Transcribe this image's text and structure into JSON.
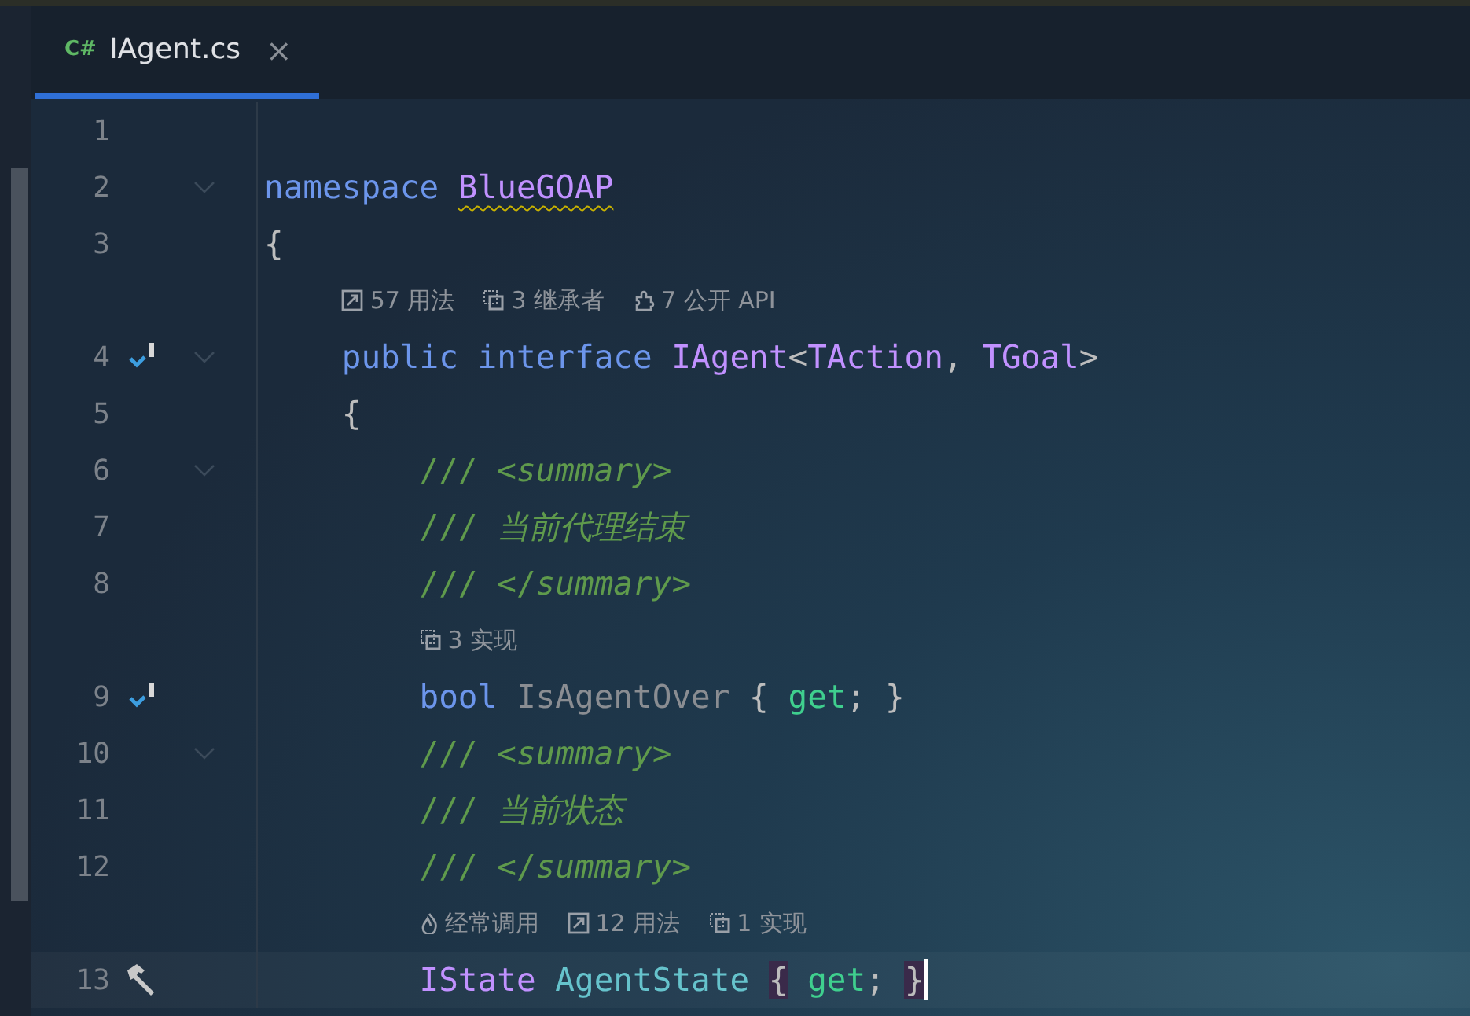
{
  "tab": {
    "lang": "C#",
    "title": "IAgent.cs",
    "close": "×",
    "selected": true
  },
  "lines": [
    {
      "kind": "code",
      "number": "1"
    },
    {
      "kind": "code",
      "number": "2",
      "fold": true,
      "tokens": [
        {
          "kind": "kw",
          "s": "namespace "
        },
        {
          "kind": "type",
          "s": "BlueGOAP",
          "warn": true
        }
      ]
    },
    {
      "kind": "code",
      "number": "3",
      "tokens": [
        {
          "kind": "p",
          "s": "{"
        }
      ]
    },
    {
      "kind": "hint",
      "items": [
        {
          "kind": "usages",
          "s": "57 用法"
        },
        {
          "kind": "squares",
          "s": "3 继承者"
        },
        {
          "kind": "puzzle",
          "s": "7 公开 API"
        }
      ]
    },
    {
      "kind": "code",
      "number": "4",
      "marker": {
        "kind": "implemented"
      },
      "fold": true,
      "tokens": [
        {
          "kind": "kw",
          "s": "    public interface"
        },
        {
          "kind": "type",
          "s": " IAgent"
        },
        {
          "kind": "p",
          "s": "<"
        },
        {
          "kind": "type",
          "s": "TAction"
        },
        {
          "kind": "p",
          "s": ", "
        },
        {
          "kind": "type",
          "s": "TGoal"
        },
        {
          "kind": "p",
          "s": ">"
        }
      ]
    },
    {
      "kind": "code",
      "number": "5",
      "tokens": [
        {
          "kind": "p",
          "s": "    {"
        }
      ]
    },
    {
      "kind": "code",
      "number": "6",
      "fold": true,
      "tokens": [
        {
          "kind": "doc",
          "s": "        /// <"
        },
        {
          "kind": "doctag",
          "s": "summary"
        },
        {
          "kind": "doc",
          "s": ">"
        }
      ]
    },
    {
      "kind": "code",
      "number": "7",
      "tokens": [
        {
          "kind": "doc",
          "s": "        /// "
        },
        {
          "kind": "doctag",
          "s": "当前代理结束"
        }
      ]
    },
    {
      "kind": "code",
      "number": "8",
      "tokens": [
        {
          "kind": "doc",
          "s": "        /// </"
        },
        {
          "kind": "doctag",
          "s": "summary"
        },
        {
          "kind": "doc",
          "s": ">"
        }
      ]
    },
    {
      "kind": "hint",
      "items": [
        {
          "kind": "squares",
          "s": "3 实现"
        }
      ]
    },
    {
      "kind": "code",
      "number": "9",
      "marker": {
        "kind": "implemented"
      },
      "tokens": [
        {
          "kind": "kw",
          "s": "        bool"
        },
        {
          "kind": "unused",
          "s": " IsAgentOver"
        },
        {
          "kind": "p",
          "s": " { "
        },
        {
          "kind": "acc",
          "s": "get"
        },
        {
          "kind": "p",
          "s": "; }"
        }
      ]
    },
    {
      "kind": "code",
      "number": "10",
      "fold": true,
      "tokens": [
        {
          "kind": "doc",
          "s": "        /// <"
        },
        {
          "kind": "doctag",
          "s": "summary"
        },
        {
          "kind": "doc",
          "s": ">"
        }
      ]
    },
    {
      "kind": "code",
      "number": "11",
      "tokens": [
        {
          "kind": "doc",
          "s": "        /// "
        },
        {
          "kind": "doctag",
          "s": "当前状态"
        }
      ]
    },
    {
      "kind": "code",
      "number": "12",
      "tokens": [
        {
          "kind": "doc",
          "s": "        /// </"
        },
        {
          "kind": "doctag",
          "s": "summary"
        },
        {
          "kind": "doc",
          "s": ">"
        }
      ]
    },
    {
      "kind": "hint",
      "items": [
        {
          "kind": "flame",
          "s": "经常调用"
        },
        {
          "kind": "usages",
          "s": "12 用法"
        },
        {
          "kind": "squares",
          "s": "1 实现"
        }
      ]
    },
    {
      "kind": "code",
      "number": "13",
      "marker": {
        "kind": "hammer"
      },
      "current": true,
      "tokens": [
        {
          "kind": "type",
          "s": "        IState"
        },
        {
          "kind": "prop",
          "s": " AgentState "
        },
        {
          "kind": "p",
          "s": "{",
          "match": true
        },
        {
          "kind": "acc",
          "s": " get"
        },
        {
          "kind": "p",
          "s": "; "
        },
        {
          "kind": "p",
          "s": "}",
          "match": true
        }
      ]
    }
  ]
}
